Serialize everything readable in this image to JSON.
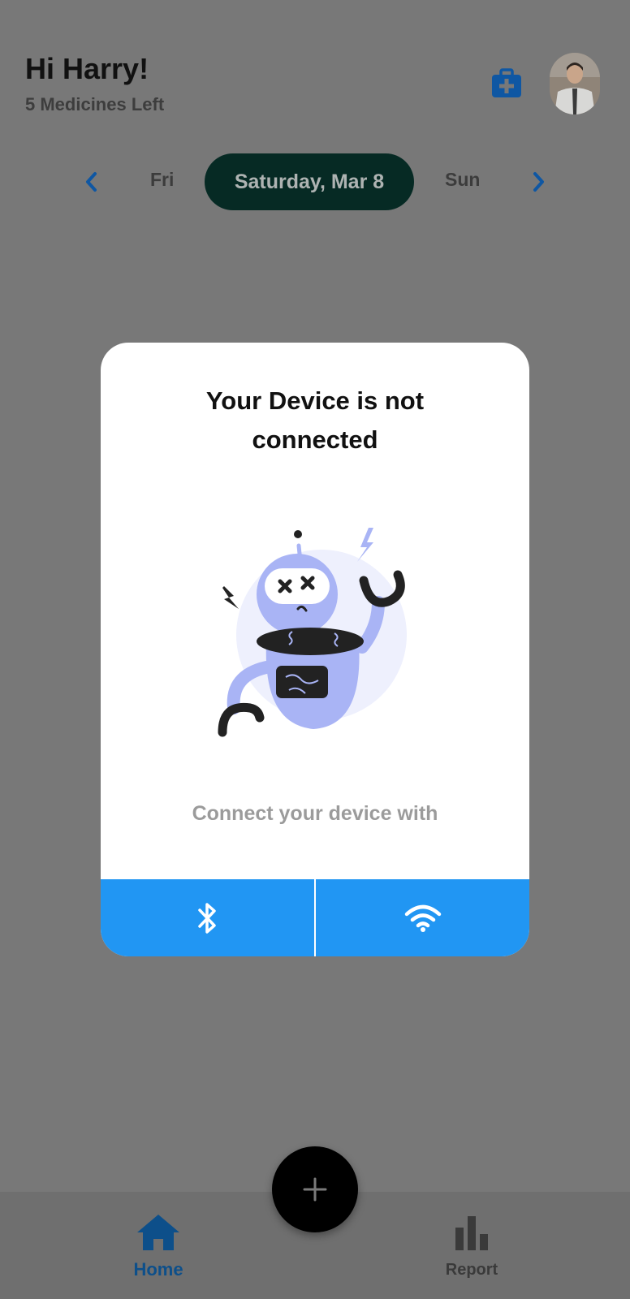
{
  "header": {
    "greeting": "Hi Harry!",
    "subtitle": "5 Medicines Left"
  },
  "date_selector": {
    "previous_day": "Fri",
    "selected_day": "Saturday, Mar 8",
    "next_day": "Sun"
  },
  "modal": {
    "title_line1": "Your Device is not",
    "title_line2": "connected",
    "connect_prompt": "Connect your device with"
  },
  "bottom_nav": {
    "home_label": "Home",
    "report_label": "Report"
  },
  "icons": {
    "kit": "medical-kit-icon",
    "prev": "chevron-left-icon",
    "next": "chevron-right-icon",
    "bluetooth": "bluetooth-icon",
    "wifi": "wifi-icon",
    "home": "home-icon",
    "report": "bar-chart-icon",
    "add": "plus-icon"
  },
  "colors": {
    "accent_blue": "#2196f3",
    "dark_green": "#062a24",
    "nav_active": "#0d4f8a",
    "robot_body": "#a9b4f5"
  }
}
